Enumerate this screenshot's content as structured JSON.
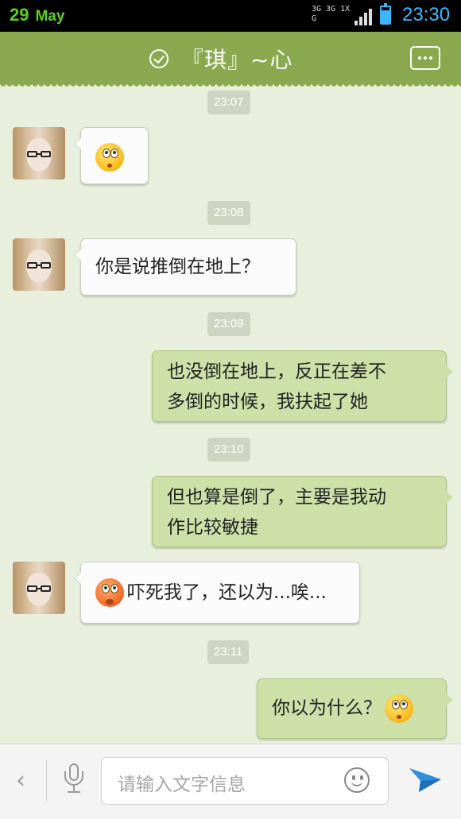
{
  "status_bar": {
    "day": "29",
    "month": "May",
    "network_label": "3G 3G 1X G",
    "time": "23:30",
    "battery_level": 0.8,
    "signal_bars": 4,
    "colors": {
      "date": "#5cd01f",
      "time": "#38b8ff"
    }
  },
  "header": {
    "title": "『琪』~心",
    "check_icon": "checkmark-circle-icon",
    "menu_icon": "more-dots-icon",
    "background": "#8aa94f"
  },
  "messages": [
    {
      "type": "timestamp",
      "text": "23:07"
    },
    {
      "type": "incoming",
      "text": "",
      "emoji": "dizzy-emoji"
    },
    {
      "type": "timestamp",
      "text": "23:08"
    },
    {
      "type": "incoming",
      "text": "你是说推倒在地上？"
    },
    {
      "type": "timestamp",
      "text": "23:09"
    },
    {
      "type": "outgoing",
      "line1": "也没倒在地上，反正在差不",
      "line2": "多倒的时候，我扶起了她"
    },
    {
      "type": "timestamp",
      "text": "23:10"
    },
    {
      "type": "outgoing",
      "line1": "但也算是倒了，主要是我动",
      "line2": "作比较敏捷"
    },
    {
      "type": "incoming",
      "text": "吓死我了，还以为...唉...",
      "emoji": "shocked-emoji"
    },
    {
      "type": "timestamp",
      "text": "23:11"
    },
    {
      "type": "outgoing",
      "text": "你以为什么？",
      "emoji": "dizzy-emoji"
    }
  ],
  "input_bar": {
    "placeholder": "请输入文字信息",
    "back_icon": "chevron-left-icon",
    "mic_icon": "microphone-icon",
    "emoji_icon": "smiley-icon",
    "send_icon": "send-icon"
  },
  "colors": {
    "chat_bg": "#e8efdc",
    "outgoing_bubble": "#cce0a8",
    "incoming_bubble": "#fbfbfb",
    "send": "#2f8fde"
  }
}
